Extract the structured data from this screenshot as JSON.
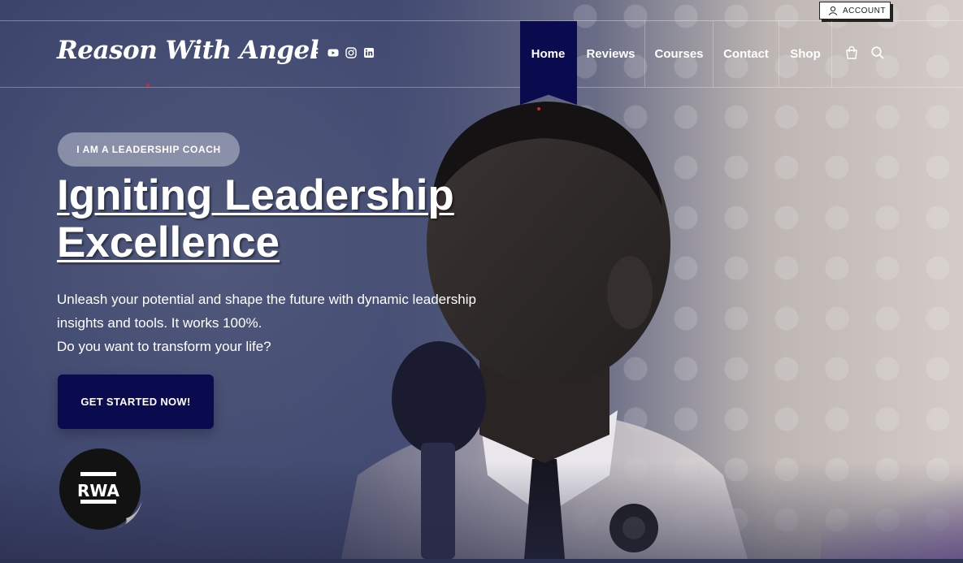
{
  "header": {
    "account_label": "ACCOUNT",
    "logo_text": "Reason With Angel",
    "socials": [
      {
        "icon": "facebook-icon"
      },
      {
        "icon": "youtube-icon"
      },
      {
        "icon": "instagram-icon"
      },
      {
        "icon": "linkedin-icon"
      }
    ],
    "nav": {
      "home": "Home",
      "reviews": "Reviews",
      "courses": "Courses",
      "contact": "Contact",
      "shop": "Shop"
    },
    "icons": [
      "cart-icon",
      "search-icon"
    ]
  },
  "hero": {
    "badge": "I AM A LEADERSHIP COACH",
    "headline_line1": "Igniting Leadership",
    "headline_line2": "Excellence",
    "desc_line1": "Unleash your potential and shape the future with dynamic leadership",
    "desc_line2": "insights and tools. It works 100%.",
    "desc_line3": "Do you want to transform your life?",
    "cta_label": "GET STARTED NOW!",
    "seal_text": "RWA"
  },
  "colors": {
    "brand_navy": "#0a0a4f",
    "accent_red": "#d9232d"
  }
}
